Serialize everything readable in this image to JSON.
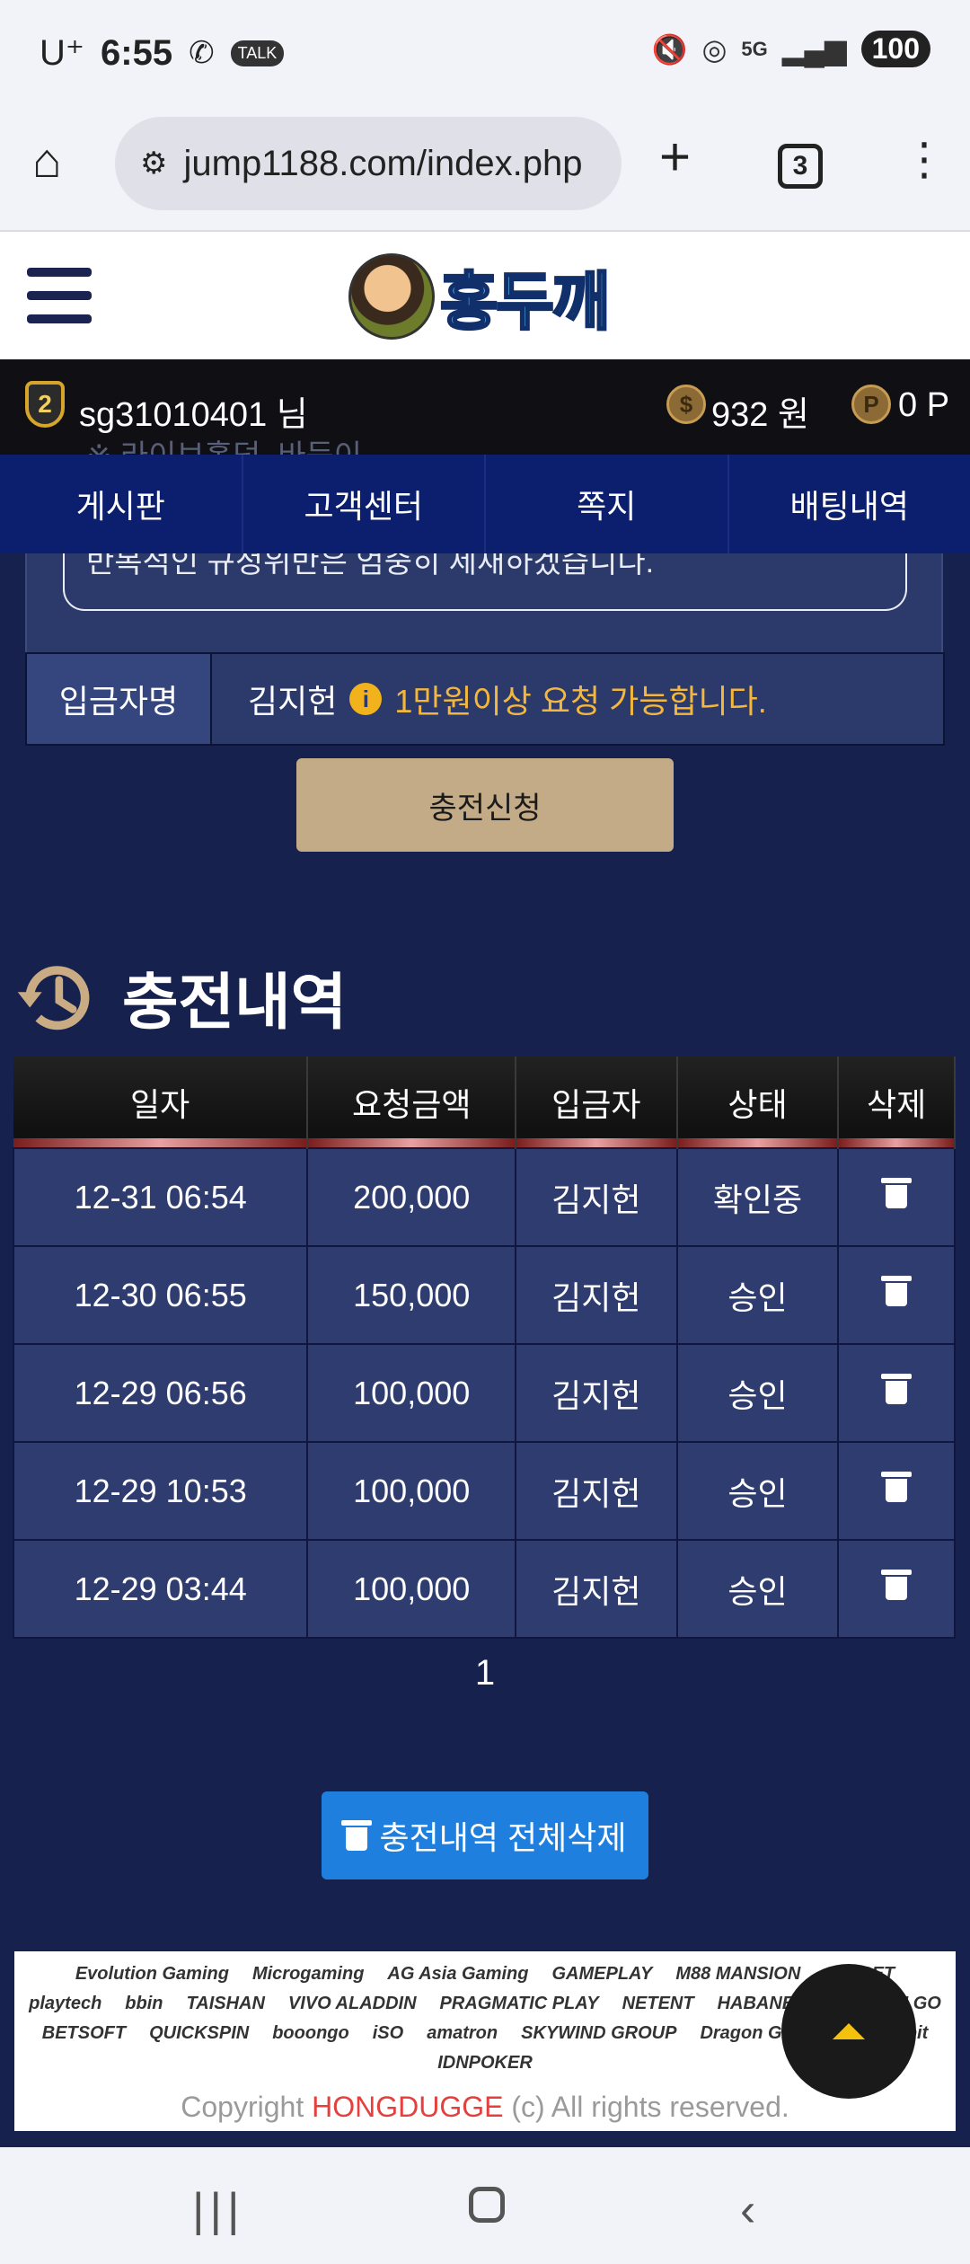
{
  "status": {
    "carrier": "U⁺",
    "time": "6:55",
    "battery": "100"
  },
  "browser": {
    "url": "jump1188.com/index.php",
    "tab_count": "3"
  },
  "header": {
    "logo_text": "홍두깨"
  },
  "user": {
    "level": "2",
    "name": "sg31010401 님",
    "money": "932 원",
    "points": "0 P",
    "ghost_note": "※ 라이브홀덤, 바둑이"
  },
  "nav": {
    "items": [
      "게시판",
      "고객센터",
      "쪽지",
      "배팅내역"
    ]
  },
  "form": {
    "notice_text": "반복적인 규정위반은 엄중히 제재하겠습니다.",
    "depositor_label": "입금자명",
    "depositor_value": "김지헌",
    "depositor_hint": "1만원이상 요청 가능합니다.",
    "charge_button": "충전신청"
  },
  "history": {
    "title": "충전내역",
    "columns": [
      "일자",
      "요청금액",
      "입금자",
      "상태",
      "삭제"
    ],
    "rows": [
      {
        "date": "12-31 06:54",
        "amount": "200,000",
        "depositor": "김지헌",
        "status": "확인중"
      },
      {
        "date": "12-30 06:55",
        "amount": "150,000",
        "depositor": "김지헌",
        "status": "승인"
      },
      {
        "date": "12-29 06:56",
        "amount": "100,000",
        "depositor": "김지헌",
        "status": "승인"
      },
      {
        "date": "12-29 10:53",
        "amount": "100,000",
        "depositor": "김지헌",
        "status": "승인"
      },
      {
        "date": "12-29 03:44",
        "amount": "100,000",
        "depositor": "김지헌",
        "status": "승인"
      }
    ],
    "page": "1",
    "delete_all_button": "충전내역 전체삭제"
  },
  "footer": {
    "providers": [
      "Evolution Gaming",
      "Microgaming",
      "AG Asia Gaming",
      "GAMEPLAY",
      "M88 MANSION",
      "ALLBET",
      "playtech",
      "bbin",
      "TAISHAN",
      "VIVO ALADDIN",
      "PRAGMATIC PLAY",
      "NETENT",
      "HABANERO",
      "PLAY'N GO",
      "BETSOFT",
      "QUICKSPIN",
      "booongo",
      "iSO",
      "amatron",
      "SKYWIND GROUP",
      "Dragon Gaming",
      "bustabit",
      "IDNPOKER"
    ],
    "copyright_prefix": "Copyright",
    "copyright_brand": "HONGDUGGE",
    "copyright_suffix": "(c) All rights reserved."
  }
}
